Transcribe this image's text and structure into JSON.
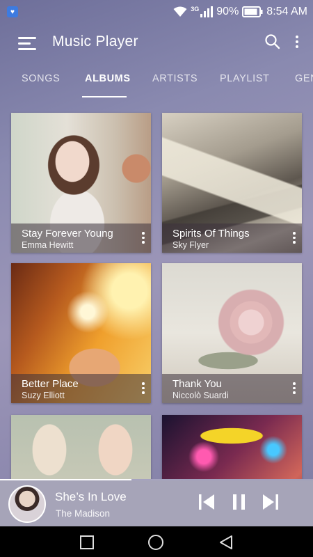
{
  "status_bar": {
    "network": "3G",
    "battery": "90%",
    "time": "8:54 AM",
    "icons": [
      "notification-icon",
      "wifi-icon",
      "signal-icon",
      "battery-icon"
    ]
  },
  "app_bar": {
    "title": "Music Player",
    "icons": [
      "menu-icon",
      "search-icon",
      "more-icon"
    ]
  },
  "tabs": [
    {
      "label": "SONGS",
      "active": false
    },
    {
      "label": "ALBUMS",
      "active": true
    },
    {
      "label": "ARTISTS",
      "active": false
    },
    {
      "label": "PLAYLIST",
      "active": false
    },
    {
      "label": "GEN",
      "active": false
    }
  ],
  "albums": [
    {
      "title": "Stay Forever Young",
      "artist": "Emma Hewitt"
    },
    {
      "title": "Spirits Of Things",
      "artist": "Sky Flyer"
    },
    {
      "title": "Better Place",
      "artist": "Suzy Elliott"
    },
    {
      "title": "Thank You",
      "artist": "Niccolò Suardi"
    },
    {
      "title": "",
      "artist": ""
    },
    {
      "title": "",
      "artist": ""
    }
  ],
  "now_playing": {
    "title": "She’s In Love",
    "artist": "The Madison",
    "progress": 0.42,
    "controls": [
      "previous-icon",
      "pause-icon",
      "next-icon"
    ]
  },
  "nav_bar": {
    "buttons": [
      "recents-icon",
      "home-icon",
      "back-icon"
    ]
  },
  "colors": {
    "accent": "#ffffff",
    "background": "#8a8ab0",
    "now_playing_bg": "#a6a4b8"
  }
}
